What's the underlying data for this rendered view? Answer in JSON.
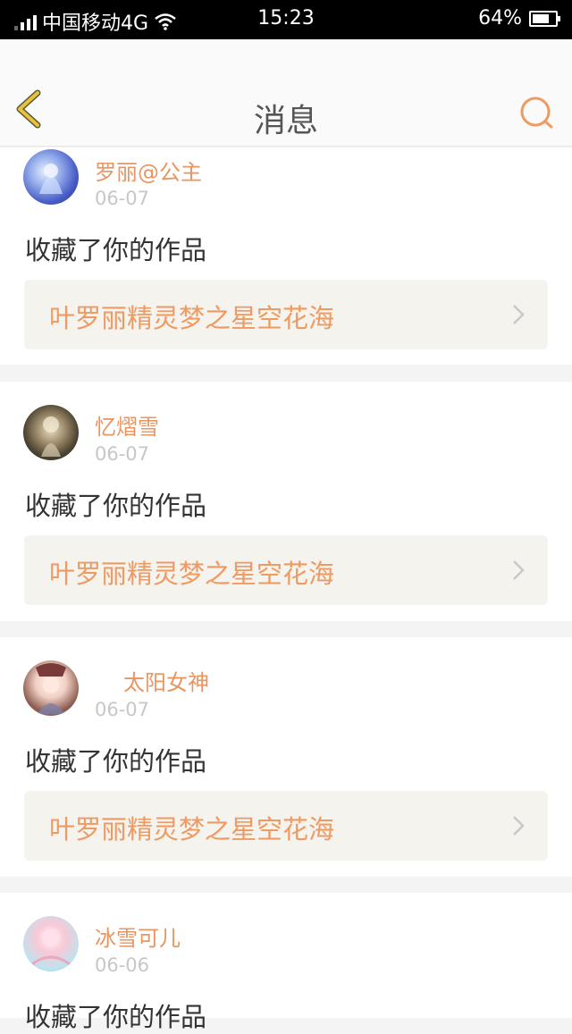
{
  "status_bar": {
    "carrier": "中国移动4G",
    "time": "15:23",
    "battery": "64%",
    "battery_level": 0.64
  },
  "header": {
    "title": "消息"
  },
  "messages": [
    {
      "user": "罗丽@公主",
      "date": "06-07",
      "action": "收藏了你的作品",
      "work_title": "叶罗丽精灵梦之星空花海"
    },
    {
      "user": "忆熠雪",
      "date": "06-07",
      "action": "收藏了你的作品",
      "work_title": "叶罗丽精灵梦之星空花海"
    },
    {
      "user": "太阳女神",
      "date": "06-07",
      "action": "收藏了你的作品",
      "work_title": "叶罗丽精灵梦之星空花海"
    },
    {
      "user": "冰雪可儿",
      "date": "06-06",
      "action": "收藏了你的作品"
    }
  ],
  "colors": {
    "accent": "#ee9a63",
    "back_icon": "#e8c23a",
    "status_bar_bg": "#000000"
  },
  "icons": {
    "back": "chevron-left-icon",
    "search": "search-icon",
    "work_arrow": "chevron-right-icon"
  }
}
